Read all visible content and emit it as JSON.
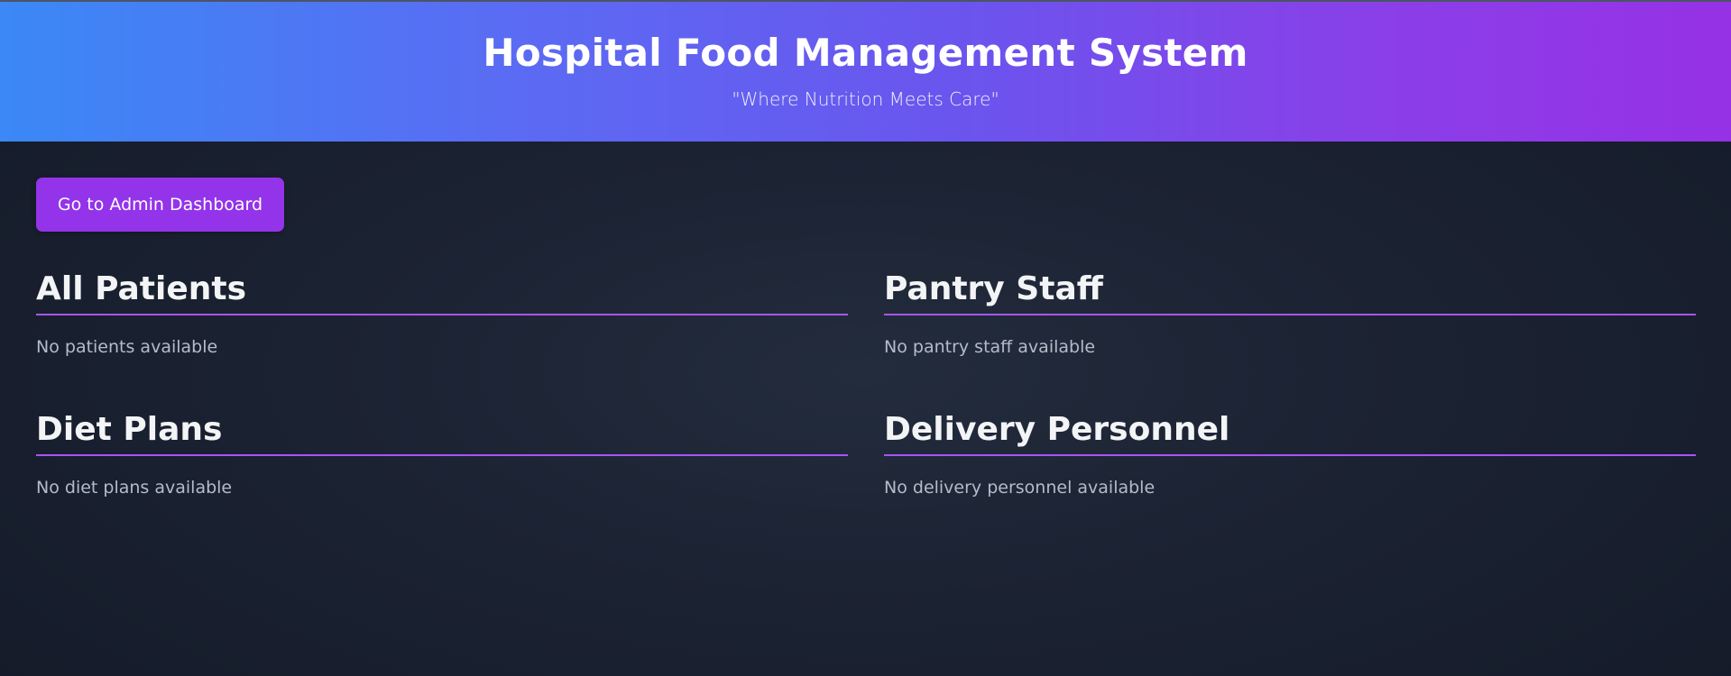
{
  "header": {
    "title": "Hospital Food Management System",
    "tagline": "\"Where Nutrition Meets Care\""
  },
  "actions": {
    "admin_dashboard_label": "Go to Admin Dashboard"
  },
  "sections": {
    "patients": {
      "title": "All Patients",
      "empty_text": "No patients available"
    },
    "pantry_staff": {
      "title": "Pantry Staff",
      "empty_text": "No pantry staff available"
    },
    "diet_plans": {
      "title": "Diet Plans",
      "empty_text": "No diet plans available"
    },
    "delivery_personnel": {
      "title": "Delivery Personnel",
      "empty_text": "No delivery personnel available"
    }
  },
  "colors": {
    "header_gradient_start": "#3b88f6",
    "header_gradient_end": "#9631e6",
    "accent": "#9333ea",
    "section_rule": "#a855f7",
    "background": "#1b2232"
  }
}
